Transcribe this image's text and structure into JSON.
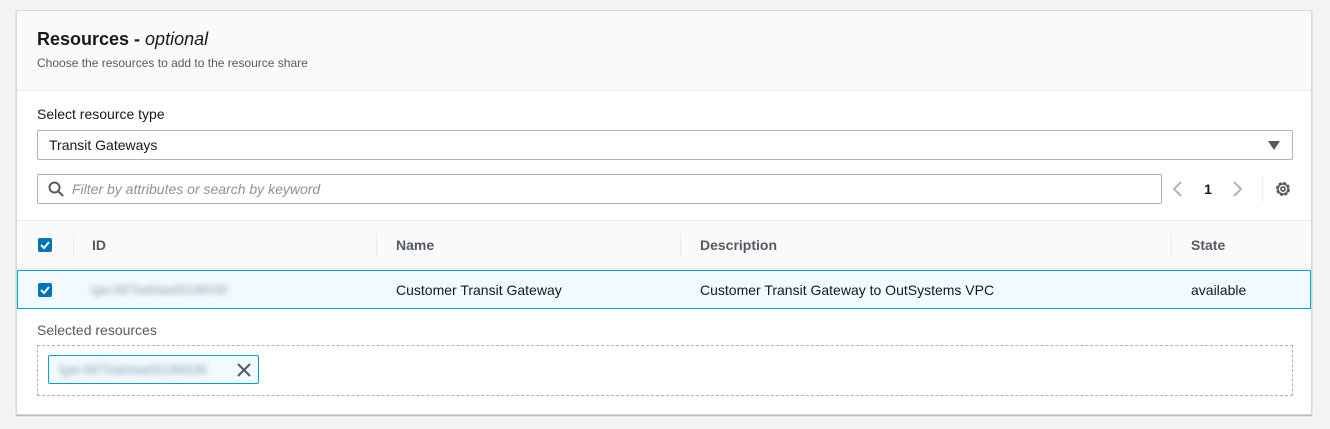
{
  "panel": {
    "title": "Resources - ",
    "title_optional": "optional",
    "subtitle": "Choose the resources to add to the resource share"
  },
  "resource_type": {
    "label": "Select resource type",
    "selected": "Transit Gateways"
  },
  "search": {
    "placeholder": "Filter by attributes or search by keyword",
    "value": ""
  },
  "pagination": {
    "current_page": "1"
  },
  "table": {
    "columns": [
      "ID",
      "Name",
      "Description",
      "State"
    ],
    "rows": [
      {
        "selected": true,
        "id": "tgw-0875a64aa05196538",
        "name": "Customer Transit Gateway",
        "description": "Customer Transit Gateway to OutSystems VPC",
        "state": "available"
      }
    ]
  },
  "selected_resources": {
    "label": "Selected resources",
    "tokens": [
      "tgw-0875a64aa05196538"
    ]
  },
  "icons": {
    "search": "search-icon",
    "previous": "chevron-left-icon",
    "next": "chevron-right-icon",
    "settings": "gear-icon",
    "caret": "caret-down-icon",
    "remove": "close-icon"
  },
  "colors": {
    "accent": "#0073bb",
    "selected_row_bg": "#f1faff",
    "selected_border": "#00a1c9"
  }
}
